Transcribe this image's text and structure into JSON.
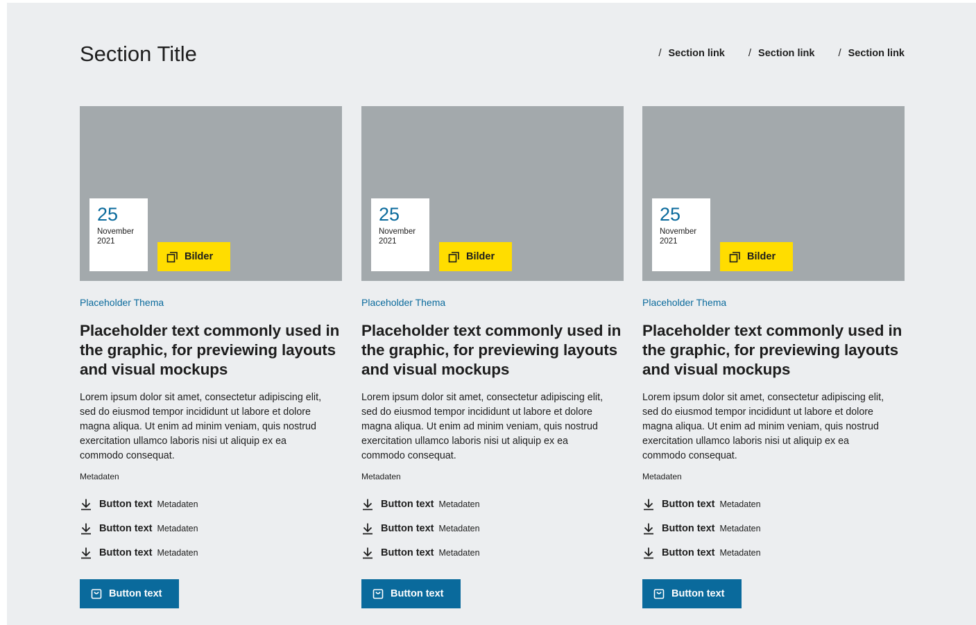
{
  "section": {
    "title": "Section Title",
    "links": [
      {
        "label": "Section link"
      },
      {
        "label": "Section link"
      },
      {
        "label": "Section link"
      }
    ]
  },
  "colors": {
    "background": "#eceef0",
    "accent_blue": "#0a6a9c",
    "badge_yellow": "#ffdd00",
    "image_placeholder": "#a3a9ac"
  },
  "cards": [
    {
      "date": {
        "day": "25",
        "month": "November",
        "year": "2021"
      },
      "badge": {
        "icon": "gallery-icon",
        "label": "Bilder"
      },
      "topic": "Placeholder Thema",
      "headline": "Placeholder text commonly used in the graphic, for previewing layouts and visual mockups",
      "body": "Lorem ipsum dolor sit amet, consectetur adipiscing elit, sed do eiusmod tempor incididunt ut labore et dolore magna aliqua. Ut enim ad minim veniam, quis nostrud exercitation ullamco laboris nisi ut aliquip ex ea commodo consequat.",
      "meta": "Metadaten",
      "downloads": [
        {
          "label": "Button text",
          "meta": "Metadaten"
        },
        {
          "label": "Button text",
          "meta": "Metadaten"
        },
        {
          "label": "Button text",
          "meta": "Metadaten"
        }
      ],
      "cta": {
        "icon": "shopping-bag-icon",
        "label": "Button text"
      }
    },
    {
      "date": {
        "day": "25",
        "month": "November",
        "year": "2021"
      },
      "badge": {
        "icon": "gallery-icon",
        "label": "Bilder"
      },
      "topic": "Placeholder Thema",
      "headline": "Placeholder text commonly used in the graphic, for previewing layouts and visual mockups",
      "body": "Lorem ipsum dolor sit amet, consectetur adipiscing elit, sed do eiusmod tempor incididunt ut labore et dolore magna aliqua. Ut enim ad minim veniam, quis nostrud exercitation ullamco laboris nisi ut aliquip ex ea commodo consequat.",
      "meta": "Metadaten",
      "downloads": [
        {
          "label": "Button text",
          "meta": "Metadaten"
        },
        {
          "label": "Button text",
          "meta": "Metadaten"
        },
        {
          "label": "Button text",
          "meta": "Metadaten"
        }
      ],
      "cta": {
        "icon": "shopping-bag-icon",
        "label": "Button text"
      }
    },
    {
      "date": {
        "day": "25",
        "month": "November",
        "year": "2021"
      },
      "badge": {
        "icon": "gallery-icon",
        "label": "Bilder"
      },
      "topic": "Placeholder Thema",
      "headline": "Placeholder text commonly used in the graphic, for previewing layouts and visual mockups",
      "body": "Lorem ipsum dolor sit amet, consectetur adipiscing elit, sed do eiusmod tempor incididunt ut labore et dolore magna aliqua. Ut enim ad minim veniam, quis nostrud exercitation ullamco laboris nisi ut aliquip ex ea commodo consequat.",
      "meta": "Metadaten",
      "downloads": [
        {
          "label": "Button text",
          "meta": "Metadaten"
        },
        {
          "label": "Button text",
          "meta": "Metadaten"
        },
        {
          "label": "Button text",
          "meta": "Metadaten"
        }
      ],
      "cta": {
        "icon": "shopping-bag-icon",
        "label": "Button text"
      }
    }
  ]
}
